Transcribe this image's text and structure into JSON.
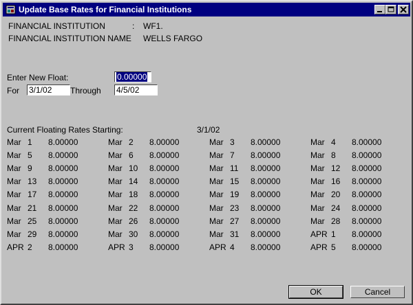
{
  "window": {
    "title": "Update Base Rates for Financial Institutions"
  },
  "header": {
    "fi_label": "FINANCIAL INSTITUTION",
    "fi_colon": ":",
    "fi_value": "WF1.",
    "fi_name_label": "FINANCIAL INSTITUTION NAME",
    "fi_name_value": "WELLS FARGO"
  },
  "form": {
    "float_label": "Enter New Float:",
    "float_value": "0.00000",
    "for_label": "For",
    "for_value": "3/1/02",
    "through_label": "Through",
    "through_value": "4/5/02"
  },
  "rates": {
    "heading": "Current Floating Rates Starting:",
    "start_date": "3/1/02",
    "rows": [
      [
        {
          "m": "Mar",
          "d": "1",
          "v": "8.00000"
        },
        {
          "m": "Mar",
          "d": "2",
          "v": "8.00000"
        },
        {
          "m": "Mar",
          "d": "3",
          "v": "8.00000"
        },
        {
          "m": "Mar",
          "d": "4",
          "v": "8.00000"
        }
      ],
      [
        {
          "m": "Mar",
          "d": "5",
          "v": "8.00000"
        },
        {
          "m": "Mar",
          "d": "6",
          "v": "8.00000"
        },
        {
          "m": "Mar",
          "d": "7",
          "v": "8.00000"
        },
        {
          "m": "Mar",
          "d": "8",
          "v": "8.00000"
        }
      ],
      [
        {
          "m": "Mar",
          "d": "9",
          "v": "8.00000"
        },
        {
          "m": "Mar",
          "d": "10",
          "v": "8.00000"
        },
        {
          "m": "Mar",
          "d": "11",
          "v": "8.00000"
        },
        {
          "m": "Mar",
          "d": "12",
          "v": "8.00000"
        }
      ],
      [
        {
          "m": "Mar",
          "d": "13",
          "v": "8.00000"
        },
        {
          "m": "Mar",
          "d": "14",
          "v": "8.00000"
        },
        {
          "m": "Mar",
          "d": "15",
          "v": "8.00000"
        },
        {
          "m": "Mar",
          "d": "16",
          "v": "8.00000"
        }
      ],
      [
        {
          "m": "Mar",
          "d": "17",
          "v": "8.00000"
        },
        {
          "m": "Mar",
          "d": "18",
          "v": "8.00000"
        },
        {
          "m": "Mar",
          "d": "19",
          "v": "8.00000"
        },
        {
          "m": "Mar",
          "d": "20",
          "v": "8.00000"
        }
      ],
      [
        {
          "m": "Mar",
          "d": "21",
          "v": "8.00000"
        },
        {
          "m": "Mar",
          "d": "22",
          "v": "8.00000"
        },
        {
          "m": "Mar",
          "d": "23",
          "v": "8.00000"
        },
        {
          "m": "Mar",
          "d": "24",
          "v": "8.00000"
        }
      ],
      [
        {
          "m": "Mar",
          "d": "25",
          "v": "8.00000"
        },
        {
          "m": "Mar",
          "d": "26",
          "v": "8.00000"
        },
        {
          "m": "Mar",
          "d": "27",
          "v": "8.00000"
        },
        {
          "m": "Mar",
          "d": "28",
          "v": "8.00000"
        }
      ],
      [
        {
          "m": "Mar",
          "d": "29",
          "v": "8.00000"
        },
        {
          "m": "Mar",
          "d": "30",
          "v": "8.00000"
        },
        {
          "m": "Mar",
          "d": "31",
          "v": "8.00000"
        },
        {
          "m": "APR",
          "d": "1",
          "v": "8.00000"
        }
      ],
      [
        {
          "m": "APR",
          "d": "2",
          "v": "8.00000"
        },
        {
          "m": "APR",
          "d": "3",
          "v": "8.00000"
        },
        {
          "m": "APR",
          "d": "4",
          "v": "8.00000"
        },
        {
          "m": "APR",
          "d": "5",
          "v": "8.00000"
        }
      ]
    ]
  },
  "buttons": {
    "ok": "OK",
    "cancel": "Cancel"
  },
  "icons": {
    "system": "app-icon",
    "minimize": "minimize-icon",
    "maximize": "maximize-icon",
    "close": "close-icon"
  },
  "colors": {
    "titlebar": "#000080",
    "face": "#c0c0c0",
    "selection": "#000080"
  }
}
